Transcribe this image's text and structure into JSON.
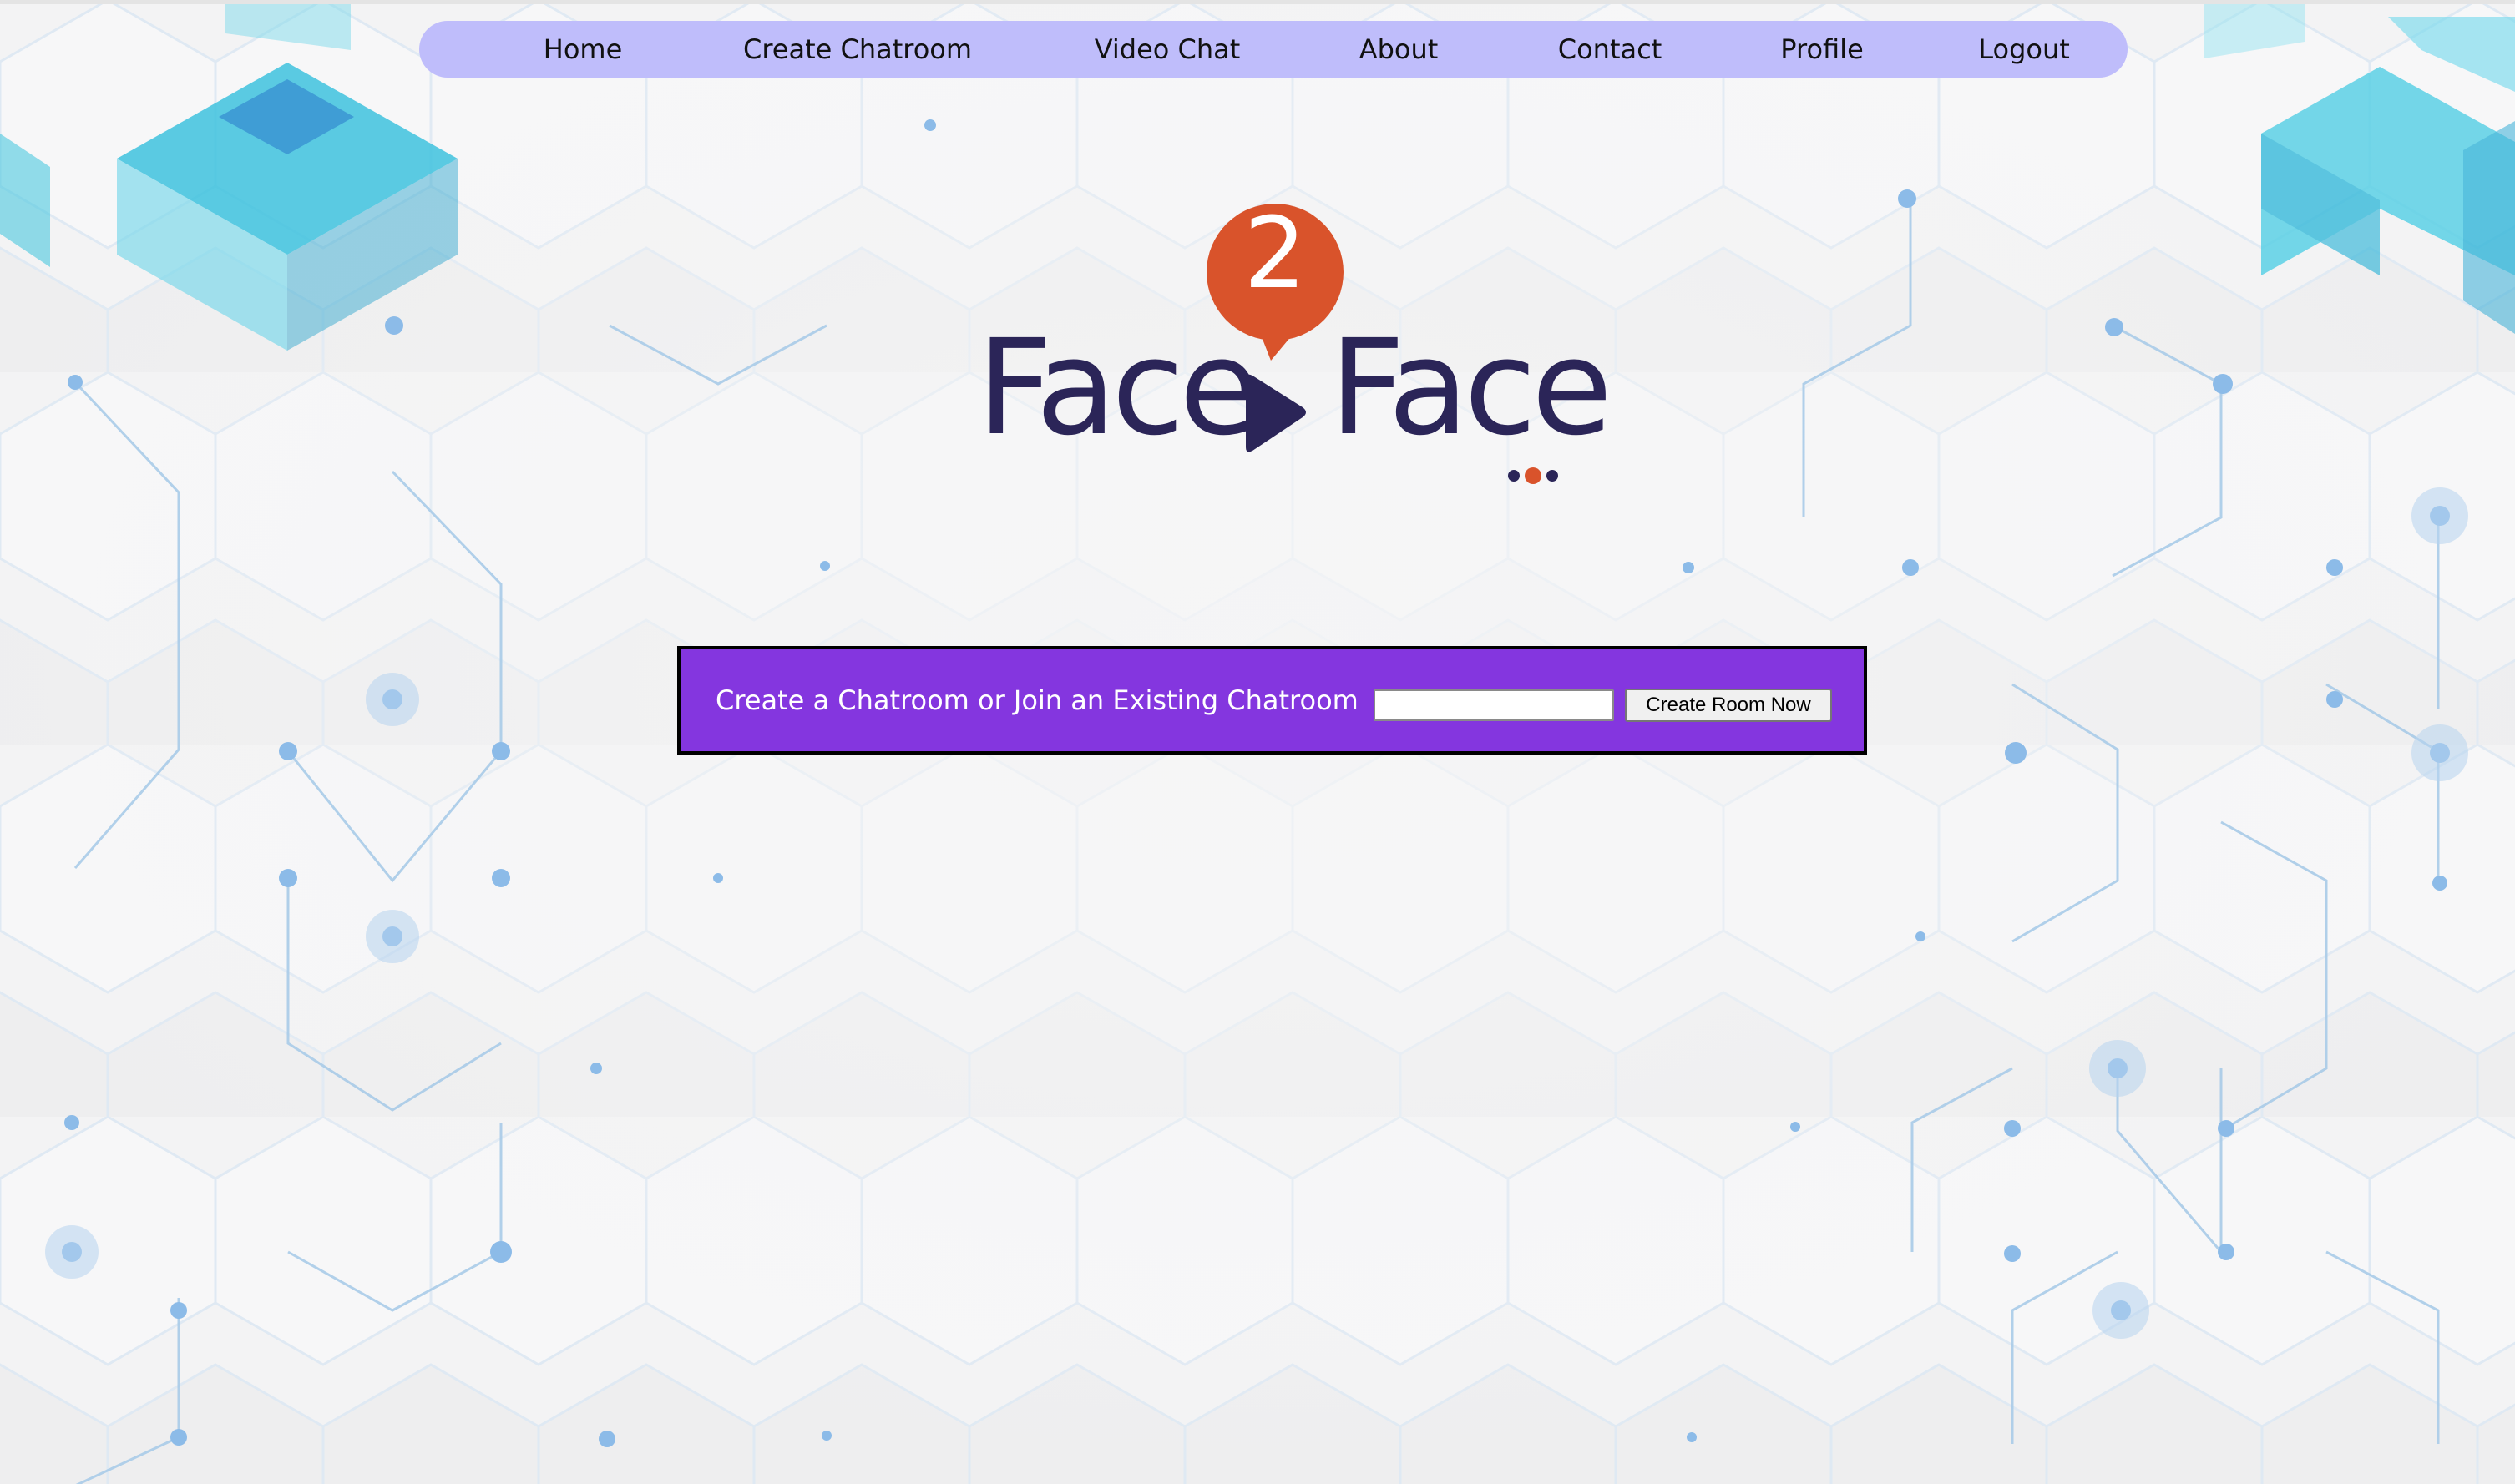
{
  "nav": {
    "items": [
      {
        "label": "Home"
      },
      {
        "label": "Create Chatroom"
      },
      {
        "label": "Video Chat"
      },
      {
        "label": "About"
      },
      {
        "label": "Contact"
      },
      {
        "label": "Profile"
      },
      {
        "label": "Logout"
      }
    ]
  },
  "logo": {
    "badge_number": "2",
    "word_left": "Face",
    "word_right": "Face",
    "icons": [
      "speech-bubble-icon",
      "play-icon",
      "dots-icon"
    ]
  },
  "create_room": {
    "label": "Create a Chatroom or Join an Existing Chatroom",
    "input_value": "",
    "input_placeholder": "",
    "button_label": "Create Room Now"
  },
  "colors": {
    "nav_background": "#bfbdfb",
    "panel_background": "#8436df",
    "logo_text": "#2b2558",
    "logo_accent": "#d9532b",
    "page_background": "#f3f3f4",
    "hex_lines": "#a9cbe8",
    "corner_cubes": "#5fcde0"
  }
}
